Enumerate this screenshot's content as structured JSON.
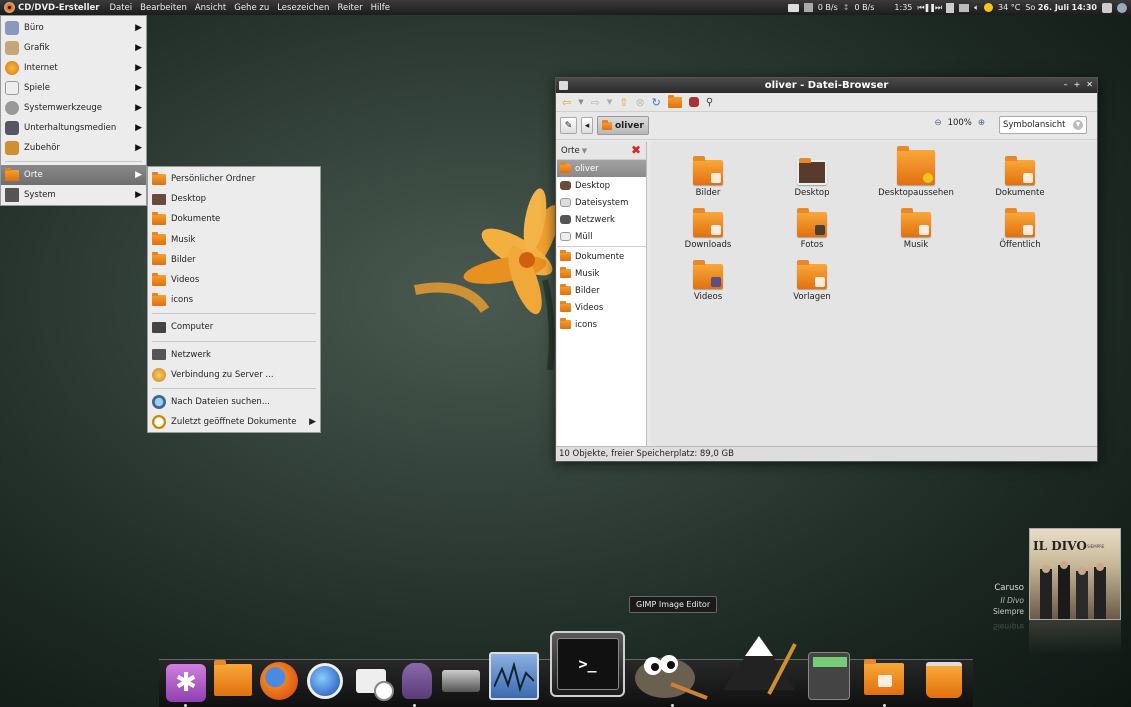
{
  "panel": {
    "app_name": "CD/DVD-Ersteller",
    "menu": [
      "Datei",
      "Bearbeiten",
      "Ansicht",
      "Gehe zu",
      "Lesezeichen",
      "Reiter",
      "Hilfe"
    ],
    "net_down": "0 B/s",
    "net_up": "0 B/s",
    "music_time": "1:35",
    "weather": "34 °C",
    "date": "So",
    "date_bold": "26. Juli",
    "time": "14:30"
  },
  "app_menu": {
    "items": [
      "Büro",
      "Grafik",
      "Internet",
      "Spiele",
      "Systemwerkzeuge",
      "Unterhaltungsmedien",
      "Zubehör"
    ],
    "places_label": "Orte",
    "system_label": "System"
  },
  "places_menu": {
    "items": [
      "Persönlicher Ordner",
      "Desktop",
      "Dokumente",
      "Musik",
      "Bilder",
      "Videos",
      "icons"
    ],
    "computer": "Computer",
    "network": "Netzwerk",
    "connect_server": "Verbindung zu Server ...",
    "search_files": "Nach Dateien suchen...",
    "recent_docs": "Zuletzt geöffnete Dokumente"
  },
  "file_browser": {
    "title": "oliver - Datei-Browser",
    "crumb": "oliver",
    "zoom": "100%",
    "view": "Symbolansicht",
    "sidebar_header": "Orte",
    "sidebar_places": [
      "oliver",
      "Desktop",
      "Dateisystem",
      "Netzwerk",
      "Müll"
    ],
    "sidebar_bookmarks": [
      "Dokumente",
      "Musik",
      "Bilder",
      "Videos",
      "icons"
    ],
    "files": [
      "Bilder",
      "Desktop",
      "Desktopaussehen",
      "Dokumente",
      "Downloads",
      "Fotos",
      "Musik",
      "Öffentlich",
      "Videos",
      "Vorlagen"
    ],
    "status": "10 Objekte, freier Speicherplatz: 89,0 GB"
  },
  "music": {
    "album_title": "IL DIVO",
    "album_sub": "SIEMPRE",
    "track": "Caruso",
    "artist": "Il Divo",
    "album": "Siempre"
  },
  "tooltip": "GIMP Image Editor",
  "terminal_glyph": ">_",
  "dock_icons": [
    "settings-icon",
    "folder-icon",
    "firefox-icon",
    "google-earth-icon",
    "mail-clock-icon",
    "pidgin-icon",
    "scanner-icon",
    "system-monitor-icon",
    "terminal-icon",
    "gimp-icon",
    "inkscape-icon",
    "calculator-icon",
    "home-folder-icon",
    "trash-icon"
  ]
}
